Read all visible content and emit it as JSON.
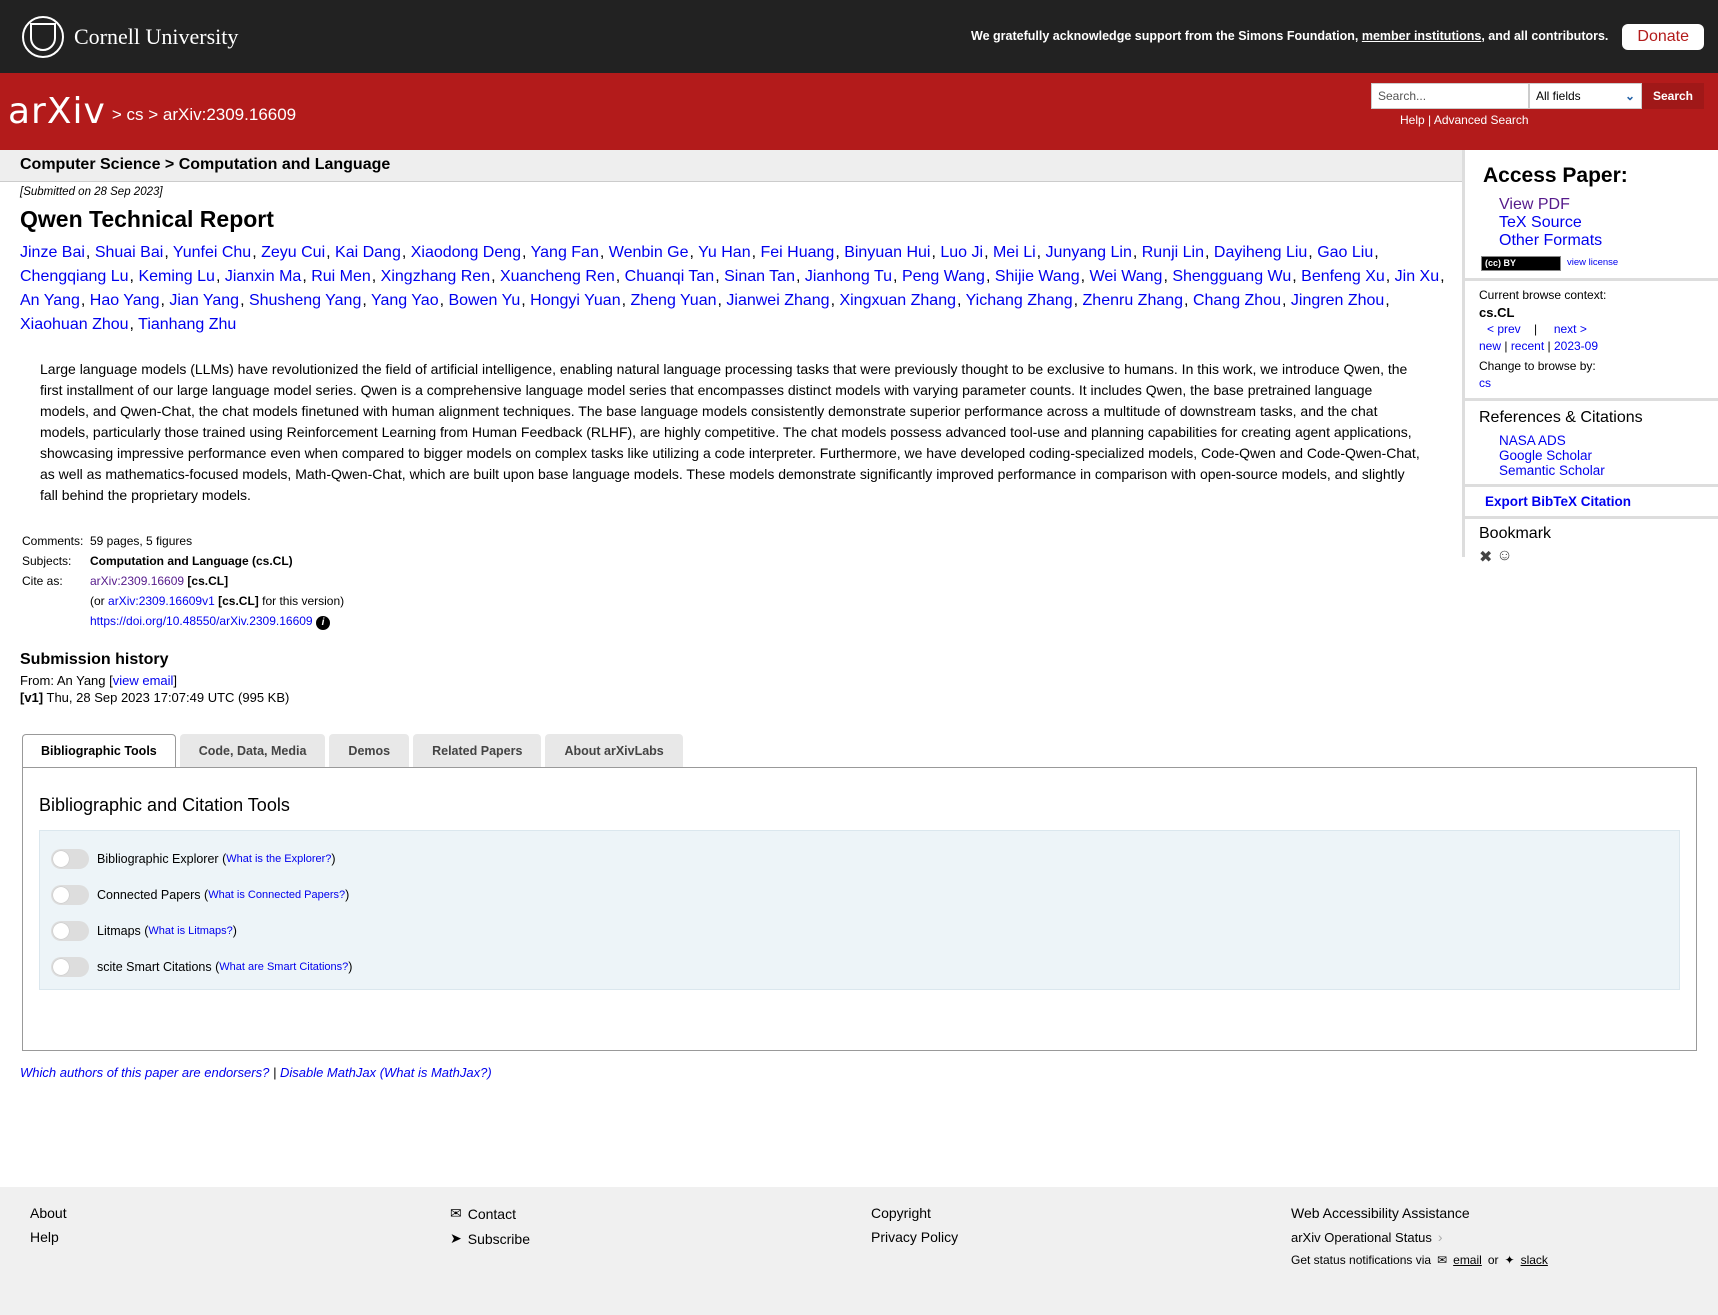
{
  "cornell": {
    "name": "Cornell University",
    "support_text": "We gratefully acknowledge support from the Simons Foundation,",
    "member_link": "member institutions",
    "support_tail": ", and all contributors.",
    "donate": "Donate"
  },
  "header": {
    "logo": "arXiv",
    "breadcrumb": "> cs > arXiv:2309.16609",
    "search_placeholder": "Search...",
    "search_field": "All fields",
    "search_button": "Search",
    "help": "Help",
    "advanced": "Advanced Search"
  },
  "subheader": "Computer Science > Computation and Language",
  "paper": {
    "submitted": "[Submitted on 28 Sep 2023]",
    "title": "Qwen Technical Report",
    "authors": [
      "Jinze Bai",
      "Shuai Bai",
      "Yunfei Chu",
      "Zeyu Cui",
      "Kai Dang",
      "Xiaodong Deng",
      "Yang Fan",
      "Wenbin Ge",
      "Yu Han",
      "Fei Huang",
      "Binyuan Hui",
      "Luo Ji",
      "Mei Li",
      "Junyang Lin",
      "Runji Lin",
      "Dayiheng Liu",
      "Gao Liu",
      "Chengqiang Lu",
      "Keming Lu",
      "Jianxin Ma",
      "Rui Men",
      "Xingzhang Ren",
      "Xuancheng Ren",
      "Chuanqi Tan",
      "Sinan Tan",
      "Jianhong Tu",
      "Peng Wang",
      "Shijie Wang",
      "Wei Wang",
      "Shengguang Wu",
      "Benfeng Xu",
      "Jin Xu",
      "An Yang",
      "Hao Yang",
      "Jian Yang",
      "Shusheng Yang",
      "Yang Yao",
      "Bowen Yu",
      "Hongyi Yuan",
      "Zheng Yuan",
      "Jianwei Zhang",
      "Xingxuan Zhang",
      "Yichang Zhang",
      "Zhenru Zhang",
      "Chang Zhou",
      "Jingren Zhou",
      "Xiaohuan Zhou",
      "Tianhang Zhu"
    ],
    "abstract": "Large language models (LLMs) have revolutionized the field of artificial intelligence, enabling natural language processing tasks that were previously thought to be exclusive to humans. In this work, we introduce Qwen, the first installment of our large language model series. Qwen is a comprehensive language model series that encompasses distinct models with varying parameter counts. It includes Qwen, the base pretrained language models, and Qwen-Chat, the chat models finetuned with human alignment techniques. The base language models consistently demonstrate superior performance across a multitude of downstream tasks, and the chat models, particularly those trained using Reinforcement Learning from Human Feedback (RLHF), are highly competitive. The chat models possess advanced tool-use and planning capabilities for creating agent applications, showcasing impressive performance even when compared to bigger models on complex tasks like utilizing a code interpreter. Furthermore, we have developed coding-specialized models, Code-Qwen and Code-Qwen-Chat, as well as mathematics-focused models, Math-Qwen-Chat, which are built upon base language models. These models demonstrate significantly improved performance in comparison with open-source models, and slightly fall behind the proprietary models."
  },
  "meta": {
    "comments_label": "Comments:",
    "comments": "59 pages, 5 figures",
    "subjects_label": "Subjects:",
    "subjects": "Computation and Language (cs.CL)",
    "cite_label": "Cite as:",
    "cite_id": "arXiv:2309.16609",
    "cite_tag": "[cs.CL]",
    "or_prefix": "(or",
    "cite_v1": "arXiv:2309.16609v1",
    "cite_v1_tag": "[cs.CL]",
    "for_version": "for this version)",
    "doi": "https://doi.org/10.48550/arXiv.2309.16609",
    "info_icon": "i"
  },
  "history": {
    "heading": "Submission history",
    "from": "From: An Yang [",
    "view_email": "view email",
    "close": "]",
    "version": "[v1]",
    "version_date": "Thu, 28 Sep 2023 17:07:49 UTC (995 KB)"
  },
  "tabs": [
    "Bibliographic Tools",
    "Code, Data, Media",
    "Demos",
    "Related Papers",
    "About arXivLabs"
  ],
  "panel": {
    "title": "Bibliographic and Citation Tools",
    "tools": [
      {
        "name": "Bibliographic Explorer",
        "help": "What is the Explorer?"
      },
      {
        "name": "Connected Papers",
        "help": "What is Connected Papers?"
      },
      {
        "name": "Litmaps",
        "help": "What is Litmaps?"
      },
      {
        "name": "scite Smart Citations",
        "help": "What are Smart Citations?"
      }
    ]
  },
  "endorse": {
    "endorsers": "Which authors of this paper are endorsers?",
    "sep": "|",
    "mathjax": "Disable MathJax",
    "what_mathjax": "(What is MathJax?)"
  },
  "sidebar": {
    "access_title": "Access Paper:",
    "view_pdf": "View PDF",
    "tex_source": "TeX Source",
    "other_formats": "Other Formats",
    "cc_badge": "(cc) BY",
    "view_license": "view license",
    "browse_label": "Current browse context:",
    "context": "cs.CL",
    "prev": "< prev",
    "pipe": "|",
    "next": "next >",
    "new": "new",
    "recent": "recent",
    "month": "2023-09",
    "change_label": "Change to browse by:",
    "cs": "cs",
    "refs_title": "References & Citations",
    "nasa": "NASA ADS",
    "scholar": "Google Scholar",
    "semantic": "Semantic Scholar",
    "bibtex": "Export BibTeX Citation",
    "bookmark": "Bookmark"
  },
  "footer": {
    "about": "About",
    "help": "Help",
    "contact": "Contact",
    "subscribe": "Subscribe",
    "copyright": "Copyright",
    "privacy": "Privacy Policy",
    "accessibility": "Web Accessibility Assistance",
    "status": "arXiv Operational Status",
    "notify": "Get status notifications via",
    "email": "email",
    "or": "or",
    "slack": "slack"
  },
  "colors": {
    "brand_red": "#b31b1b",
    "link": "#0000ee",
    "visited": "#551a8b"
  }
}
